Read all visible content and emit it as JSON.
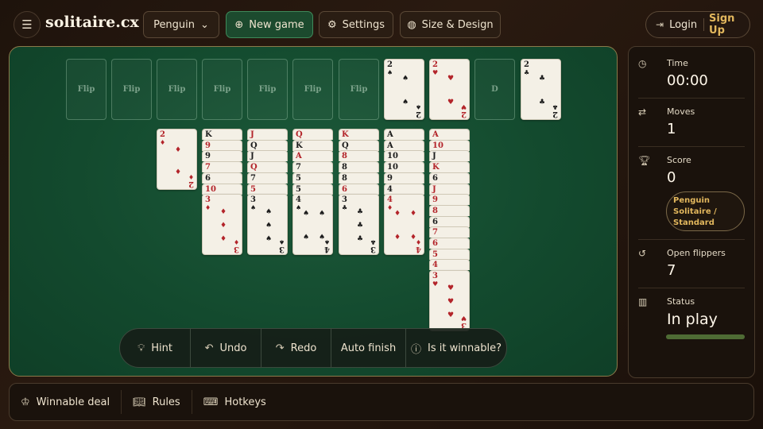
{
  "header": {
    "logo": "solitaire.cx",
    "variant_select": "Penguin",
    "new_game": "New game",
    "settings": "Settings",
    "size_design": "Size & Design",
    "login": "Login",
    "signup": "Sign Up"
  },
  "board": {
    "flip_label": "Flip",
    "foundation_label": "D",
    "top_cards": [
      {
        "rank": "2",
        "suit": "♠",
        "color": "#1d1d1d"
      },
      {
        "rank": "2",
        "suit": "♥",
        "color": "#b3242a"
      },
      {
        "rank": "2",
        "suit": "♣",
        "color": "#1d1d1d"
      }
    ],
    "columns": [
      {
        "strips": [],
        "face": {
          "rank": "2",
          "suit": "♦",
          "color": "#b3242a"
        }
      },
      {
        "strips": [
          {
            "r": "K",
            "s": "♠"
          },
          {
            "r": "9",
            "s": "♦"
          },
          {
            "r": "9",
            "s": "♠"
          },
          {
            "r": "7",
            "s": "♦"
          },
          {
            "r": "6",
            "s": "♠"
          },
          {
            "r": "10",
            "s": "♦"
          }
        ],
        "face": {
          "rank": "3",
          "suit": "♦",
          "color": "#b3242a"
        }
      },
      {
        "strips": [
          {
            "r": "J",
            "s": "♦"
          },
          {
            "r": "Q",
            "s": "♠"
          },
          {
            "r": "J",
            "s": "♠"
          },
          {
            "r": "Q",
            "s": "♦"
          },
          {
            "r": "7",
            "s": "♠"
          },
          {
            "r": "5",
            "s": "♦"
          }
        ],
        "face": {
          "rank": "3",
          "suit": "♠",
          "color": "#1d1d1d"
        }
      },
      {
        "strips": [
          {
            "r": "Q",
            "s": "♦"
          },
          {
            "r": "K",
            "s": "♠"
          },
          {
            "r": "A",
            "s": "♦"
          },
          {
            "r": "7",
            "s": "♠"
          },
          {
            "r": "5",
            "s": "♠"
          },
          {
            "r": "5",
            "s": "♠"
          }
        ],
        "face": {
          "rank": "4",
          "suit": "♠",
          "color": "#1d1d1d"
        }
      },
      {
        "strips": [
          {
            "r": "K",
            "s": "♦"
          },
          {
            "r": "Q",
            "s": "♠"
          },
          {
            "r": "8",
            "s": "♦"
          },
          {
            "r": "8",
            "s": "♠"
          },
          {
            "r": "8",
            "s": "♠"
          },
          {
            "r": "6",
            "s": "♦"
          }
        ],
        "face": {
          "rank": "3",
          "suit": "♣",
          "color": "#1d1d1d"
        }
      },
      {
        "strips": [
          {
            "r": "A",
            "s": "♠"
          },
          {
            "r": "A",
            "s": "♠"
          },
          {
            "r": "10",
            "s": "♠"
          },
          {
            "r": "10",
            "s": "♠"
          },
          {
            "r": "9",
            "s": "♠"
          },
          {
            "r": "4",
            "s": "♠"
          }
        ],
        "face": {
          "rank": "4",
          "suit": "♦",
          "color": "#b3242a"
        }
      },
      {
        "strips": [
          {
            "r": "A",
            "s": "♦"
          },
          {
            "r": "10",
            "s": "♦"
          },
          {
            "r": "J",
            "s": "♠"
          },
          {
            "r": "K",
            "s": "♦"
          },
          {
            "r": "6",
            "s": "♠"
          },
          {
            "r": "J",
            "s": "♦"
          },
          {
            "r": "9",
            "s": "♦"
          },
          {
            "r": "8",
            "s": "♦"
          },
          {
            "r": "6",
            "s": "♠"
          },
          {
            "r": "7",
            "s": "♦"
          },
          {
            "r": "6",
            "s": "♦"
          },
          {
            "r": "5",
            "s": "♦"
          },
          {
            "r": "4",
            "s": "♦"
          }
        ],
        "face": {
          "rank": "3",
          "suit": "♥",
          "color": "#b3242a"
        }
      }
    ]
  },
  "toolbar": {
    "hint": "Hint",
    "undo": "Undo",
    "redo": "Redo",
    "auto_finish": "Auto finish",
    "winnable": "Is it winnable?"
  },
  "stats": {
    "time_label": "Time",
    "time_value": "00:00",
    "moves_label": "Moves",
    "moves_value": "1",
    "score_label": "Score",
    "score_value": "0",
    "mode": "Penguin Solitaire / Standard",
    "flippers_label": "Open flippers",
    "flippers_value": "7",
    "status_label": "Status",
    "status_value": "In play",
    "status_progress": 1.0
  },
  "footer": {
    "winnable_deal": "Winnable deal",
    "rules": "Rules",
    "hotkeys": "Hotkeys"
  },
  "colors": {
    "felt": "#134a2e",
    "accent_gold": "#e2b75d",
    "red_suit": "#b3242a",
    "black_suit": "#1d1d1d"
  }
}
